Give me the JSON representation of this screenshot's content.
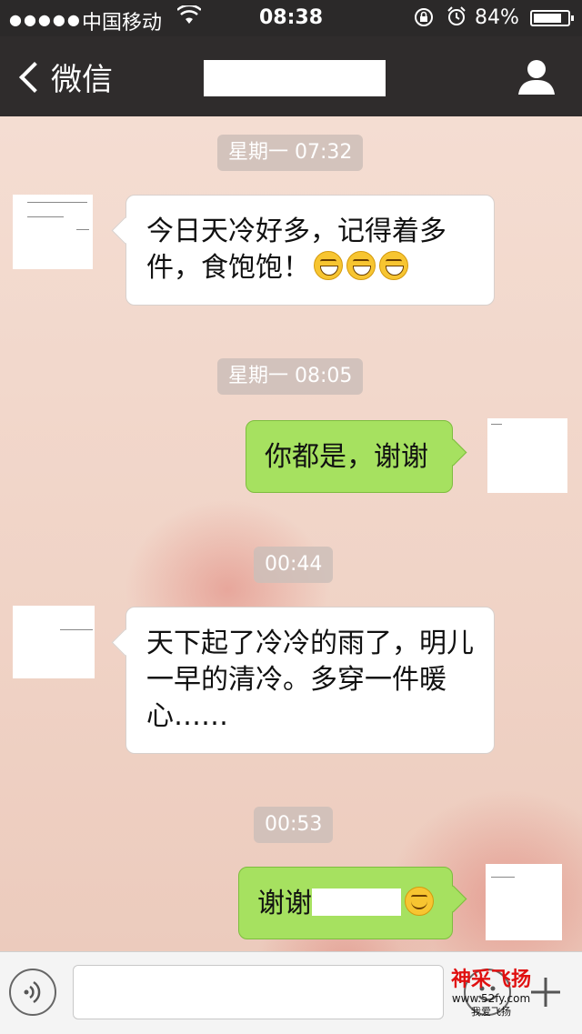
{
  "status_bar": {
    "signal": "●●●●●",
    "carrier": "中国移动",
    "time": "08:38",
    "battery_percent": "84%",
    "battery_level": 0.84
  },
  "nav": {
    "back_label": "微信"
  },
  "messages": [
    {
      "timestamp": "星期一 07:32",
      "direction": "in",
      "text": "今日天冷好多，记得着多件，食饱饱！"
    },
    {
      "timestamp": "星期一 08:05",
      "direction": "out",
      "text": "你都是，谢谢"
    },
    {
      "timestamp": "00:44",
      "direction": "in",
      "text": "天下起了冷冷的雨了，明儿一早的清冷。多穿一件暖心……"
    },
    {
      "timestamp": "00:53",
      "direction": "out",
      "text": "谢谢"
    }
  ],
  "emoji_names": [
    "grin-emoji",
    "grin-emoji",
    "grin-emoji",
    "smile-emoji"
  ],
  "watermark": {
    "title": "神采飞扬",
    "url": "www.52fy.com",
    "slogan": "我爱飞扬"
  },
  "colors": {
    "nav_bg": "#2f2c2c",
    "outgoing_bubble": "#a6e160",
    "incoming_bubble": "#ffffff"
  }
}
